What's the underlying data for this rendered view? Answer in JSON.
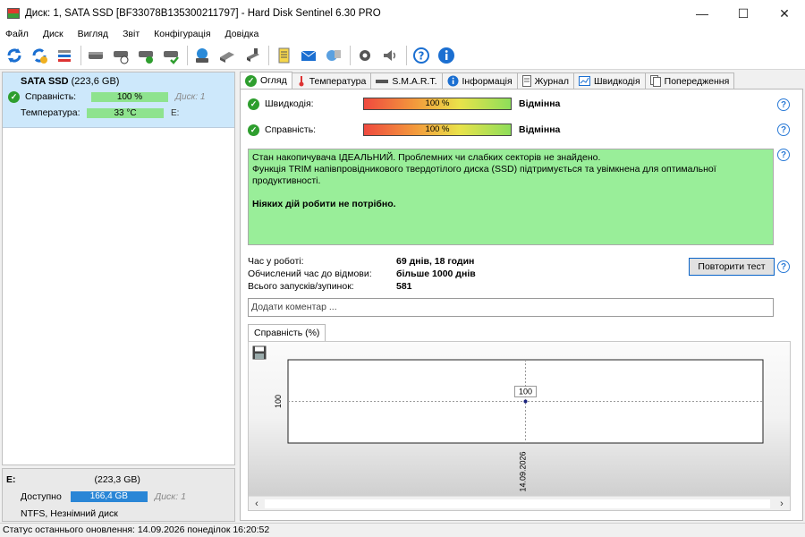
{
  "window": {
    "title": "Диск: 1, SATA SSD [BF33078B135300211797]  -  Hard Disk Sentinel 6.30 PRO",
    "min": "—",
    "max": "☐",
    "close": "✕"
  },
  "menu": [
    "Файл",
    "Диск",
    "Вигляд",
    "Звіт",
    "Конфігурація",
    "Довідка"
  ],
  "disk": {
    "name": "SATA SSD",
    "size": "(223,6 GB)",
    "health_label": "Справність:",
    "health_value": "100 %",
    "health_extra": "Диск: 1",
    "temp_label": "Температура:",
    "temp_value": "33 °C",
    "temp_extra": "E:"
  },
  "partition": {
    "letter": "E:",
    "size": "(223,3 GB)",
    "free_label": "Доступно",
    "free_value": "166,4 GB",
    "disk_ref": "Диск: 1",
    "fs": "NTFS, Незнімний диск"
  },
  "tabs": [
    "Огляд",
    "Температура",
    "S.M.A.R.T.",
    "Інформація",
    "Журнал",
    "Швидкодія",
    "Попередження"
  ],
  "metrics": {
    "performance_label": "Швидкодія:",
    "performance_value": "100 %",
    "performance_verdict": "Відмінна",
    "health_label": "Справність:",
    "health_value": "100 %",
    "health_verdict": "Відмінна"
  },
  "message": {
    "line1": "Стан накопичувача ІДЕАЛЬНИЙ. Проблемних чи слабких секторів не знайдено.",
    "line2": "Функція TRIM напівпровідникового твердотілого диска (SSD) підтримується та увімкнена для оптимальної продуктивності.",
    "action": "Ніяких дій робити не потрібно."
  },
  "info": {
    "uptime_label": "Час у роботі:",
    "uptime_value": "69 днів, 18 годин",
    "remaining_label": "Обчислений час до відмови:",
    "remaining_value": "більше 1000 днів",
    "starts_label": "Всього запусків/зупинок:",
    "starts_value": "581"
  },
  "retest_button": "Повторити тест",
  "comment_placeholder": "Додати коментар ...",
  "chart_tab": "Справність (%)",
  "chart_data": {
    "type": "line",
    "x": [
      "14.09.2026"
    ],
    "series": [
      {
        "values": [
          100
        ]
      }
    ],
    "ylabel": "",
    "ytick": "100",
    "point_label": "100",
    "grid": true
  },
  "status": "Статус останнього оновлення: 14.09.2026 понеділок 16:20:52",
  "colors": {
    "ok": "#2e9e2e",
    "free": "#2a86d6",
    "message_bg": "#99ee99",
    "accent": "#2a7ad6"
  }
}
